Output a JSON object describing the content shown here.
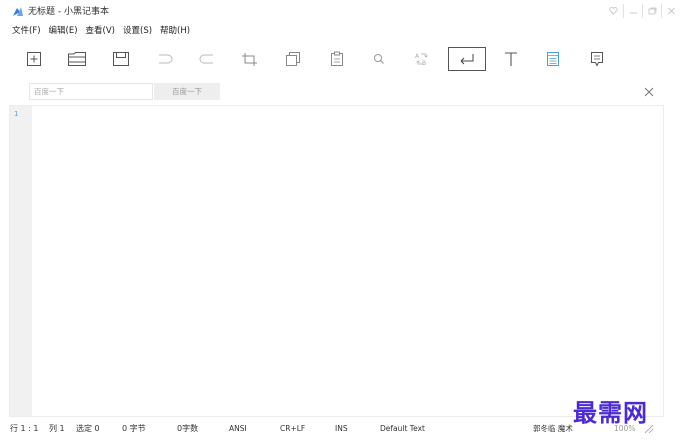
{
  "window": {
    "title": "无标题 - 小黑记事本"
  },
  "menu": [
    {
      "label": "文件(F)"
    },
    {
      "label": "编辑(E)"
    },
    {
      "label": "查看(V)"
    },
    {
      "label": "设置(S)"
    },
    {
      "label": "帮助(H)"
    }
  ],
  "toolbar": {
    "icons": [
      "new-file-icon",
      "open-folder-icon",
      "save-icon",
      "undo-icon",
      "redo-icon",
      "cut-icon",
      "copy-icon",
      "paste-icon",
      "find-icon",
      "replace-icon",
      "word-wrap-icon",
      "font-icon",
      "notes-icon",
      "comment-icon"
    ],
    "active": "word-wrap-icon",
    "accent": "#4a9fd8"
  },
  "search": {
    "placeholder": "百度一下",
    "button_label": "百度一下"
  },
  "editor": {
    "line_number": "1"
  },
  "status": {
    "position": "行 1 : 1",
    "column": "列 1",
    "selection": "选定 0",
    "bytes": "0 字节",
    "chars": "0字数",
    "encoding": "ANSI",
    "line_ending": "CR+LF",
    "insert_mode": "INS",
    "text_type": "Default Text",
    "author": "郭冬临 魔术",
    "zoom": "100%"
  },
  "watermark": {
    "text": "最需网",
    "color": "#4b2ad6"
  }
}
